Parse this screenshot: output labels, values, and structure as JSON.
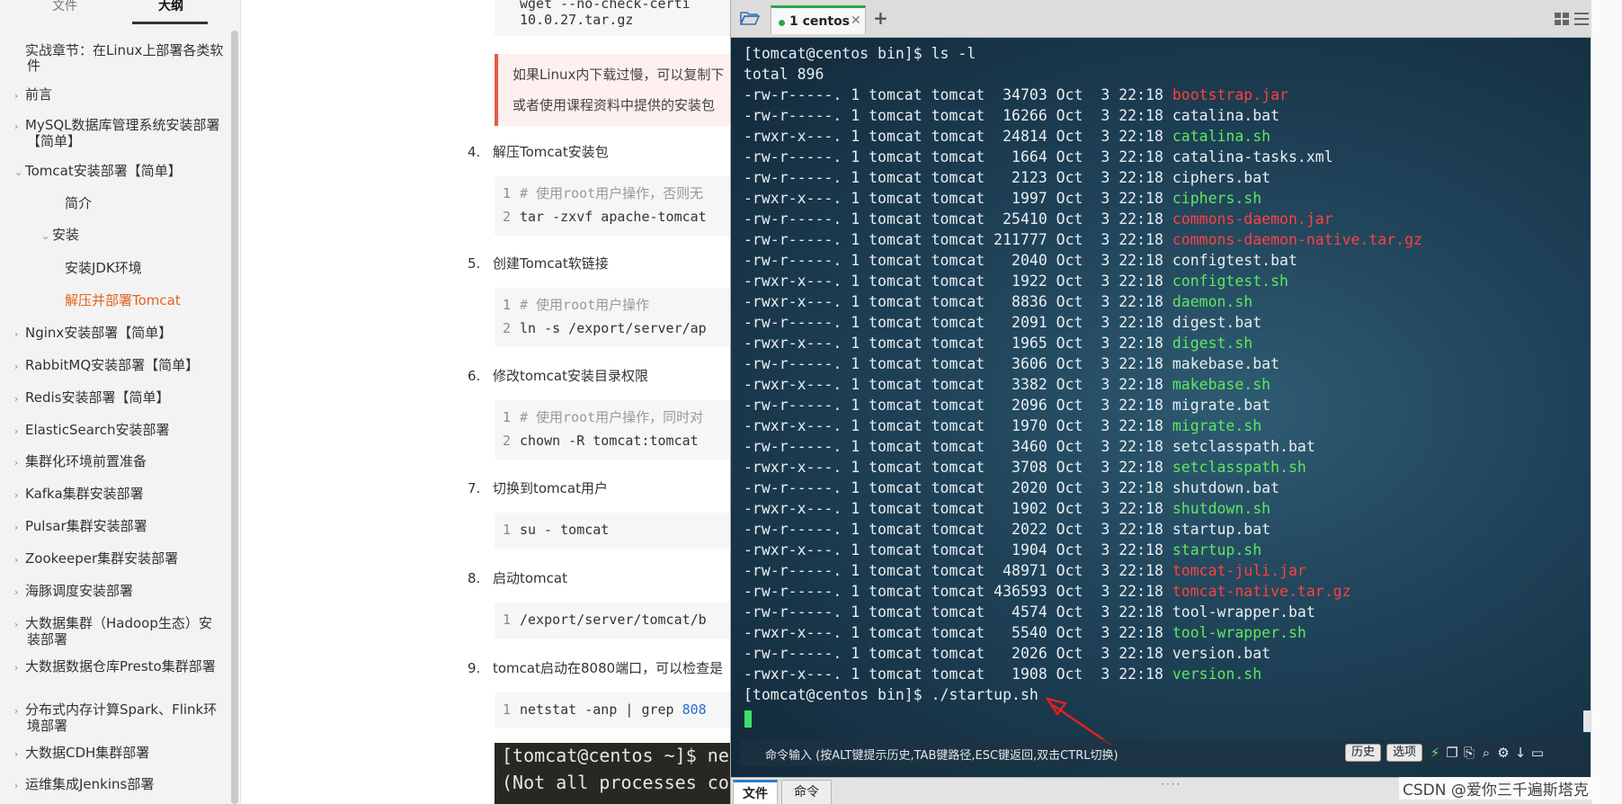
{
  "sidebar": {
    "tabs": [
      "文件",
      "大纲"
    ],
    "items": [
      {
        "label": "实战章节：在Linux上部署各类软件",
        "chev": ""
      },
      {
        "label": "前言",
        "chev": "›"
      },
      {
        "label": "MySQL数据库管理系统安装部署【简单】",
        "chev": "›"
      },
      {
        "label": "Tomcat安装部署【简单】",
        "chev": "⌄"
      },
      {
        "label": "简介",
        "chev": ""
      },
      {
        "label": "安装",
        "chev": "⌄"
      },
      {
        "label": "安装JDK环境",
        "chev": ""
      },
      {
        "label": "解压并部署Tomcat",
        "chev": ""
      },
      {
        "label": "Nginx安装部署【简单】",
        "chev": "›"
      },
      {
        "label": "RabbitMQ安装部署【简单】",
        "chev": "›"
      },
      {
        "label": "Redis安装部署【简单】",
        "chev": "›"
      },
      {
        "label": "ElasticSearch安装部署",
        "chev": "›"
      },
      {
        "label": "集群化环境前置准备",
        "chev": "›"
      },
      {
        "label": "Kafka集群安装部署",
        "chev": "›"
      },
      {
        "label": "Pulsar集群安装部署",
        "chev": "›"
      },
      {
        "label": "Zookeeper集群安装部署",
        "chev": "›"
      },
      {
        "label": "海豚调度安装部署",
        "chev": "›"
      },
      {
        "label": "大数据集群（Hadoop生态）安装部署",
        "chev": "›"
      },
      {
        "label": "大数据数据仓库Presto集群部署",
        "chev": "›"
      },
      {
        "label": "分布式内存计算Spark、Flink环境部署",
        "chev": "›"
      },
      {
        "label": "大数据CDH集群部署",
        "chev": "›"
      },
      {
        "label": "运维集成Jenkins部署",
        "chev": "›"
      }
    ]
  },
  "doc": {
    "top_code": [
      "wget --no-check-certi",
      "10.0.27.tar.gz"
    ],
    "tip": [
      "如果Linux内下载过慢，可以复制下",
      "或者使用课程资料中提供的安装包"
    ],
    "steps": [
      {
        "num": "4.",
        "title": "解压Tomcat安装包",
        "lines": [
          {
            "ln": "1",
            "comment": "# 使用root用户操作，否则无",
            "code": ""
          },
          {
            "ln": "2",
            "comment": "",
            "code": "tar -zxvf apache-tomcat"
          }
        ]
      },
      {
        "num": "5.",
        "title": "创建Tomcat软链接",
        "lines": [
          {
            "ln": "1",
            "comment": "# 使用root用户操作",
            "code": ""
          },
          {
            "ln": "2",
            "comment": "",
            "code": "ln -s /export/server/ap"
          }
        ]
      },
      {
        "num": "6.",
        "title": "修改tomcat安装目录权限",
        "lines": [
          {
            "ln": "1",
            "comment": "# 使用root用户操作，同时对",
            "code": ""
          },
          {
            "ln": "2",
            "comment": "",
            "code": "chown -R tomcat:tomcat"
          }
        ]
      },
      {
        "num": "7.",
        "title": "切换到tomcat用户",
        "lines": [
          {
            "ln": "1",
            "comment": "",
            "code": "su - tomcat"
          }
        ]
      },
      {
        "num": "8.",
        "title": "启动tomcat",
        "lines": [
          {
            "ln": "1",
            "comment": "",
            "code": "/export/server/tomcat/b"
          }
        ]
      },
      {
        "num": "9.",
        "title": "tomcat启动在8080端口，可以检查是",
        "lines": [
          {
            "ln": "1",
            "comment": "",
            "code": "netstat -anp | grep ",
            "blue": "808"
          }
        ]
      }
    ],
    "dark_block": [
      "[tomcat@centos ~]$ net",
      "(Not all processes cou"
    ]
  },
  "terminal": {
    "tab_label": "1 centos",
    "prompt_ls": "[tomcat@centos bin]$ ls -l",
    "total": "total 896",
    "files": [
      {
        "perm": "-rw-r-----.",
        "size": "34703",
        "name": "bootstrap.jar",
        "color": "red"
      },
      {
        "perm": "-rw-r-----.",
        "size": "16266",
        "name": "catalina.bat",
        "color": "white"
      },
      {
        "perm": "-rwxr-x---.",
        "size": "24814",
        "name": "catalina.sh",
        "color": "green"
      },
      {
        "perm": "-rw-r-----.",
        "size": "1664",
        "name": "catalina-tasks.xml",
        "color": "white"
      },
      {
        "perm": "-rw-r-----.",
        "size": "2123",
        "name": "ciphers.bat",
        "color": "white"
      },
      {
        "perm": "-rwxr-x---.",
        "size": "1997",
        "name": "ciphers.sh",
        "color": "green"
      },
      {
        "perm": "-rw-r-----.",
        "size": "25410",
        "name": "commons-daemon.jar",
        "color": "red"
      },
      {
        "perm": "-rw-r-----.",
        "size": "211777",
        "name": "commons-daemon-native.tar.gz",
        "color": "red"
      },
      {
        "perm": "-rw-r-----.",
        "size": "2040",
        "name": "configtest.bat",
        "color": "white"
      },
      {
        "perm": "-rwxr-x---.",
        "size": "1922",
        "name": "configtest.sh",
        "color": "green"
      },
      {
        "perm": "-rwxr-x---.",
        "size": "8836",
        "name": "daemon.sh",
        "color": "green"
      },
      {
        "perm": "-rw-r-----.",
        "size": "2091",
        "name": "digest.bat",
        "color": "white"
      },
      {
        "perm": "-rwxr-x---.",
        "size": "1965",
        "name": "digest.sh",
        "color": "green"
      },
      {
        "perm": "-rw-r-----.",
        "size": "3606",
        "name": "makebase.bat",
        "color": "white"
      },
      {
        "perm": "-rwxr-x---.",
        "size": "3382",
        "name": "makebase.sh",
        "color": "green"
      },
      {
        "perm": "-rw-r-----.",
        "size": "2096",
        "name": "migrate.bat",
        "color": "white"
      },
      {
        "perm": "-rwxr-x---.",
        "size": "1970",
        "name": "migrate.sh",
        "color": "green"
      },
      {
        "perm": "-rw-r-----.",
        "size": "3460",
        "name": "setclasspath.bat",
        "color": "white"
      },
      {
        "perm": "-rwxr-x---.",
        "size": "3708",
        "name": "setclasspath.sh",
        "color": "green"
      },
      {
        "perm": "-rw-r-----.",
        "size": "2020",
        "name": "shutdown.bat",
        "color": "white"
      },
      {
        "perm": "-rwxr-x---.",
        "size": "1902",
        "name": "shutdown.sh",
        "color": "green"
      },
      {
        "perm": "-rw-r-----.",
        "size": "2022",
        "name": "startup.bat",
        "color": "white"
      },
      {
        "perm": "-rwxr-x---.",
        "size": "1904",
        "name": "startup.sh",
        "color": "green"
      },
      {
        "perm": "-rw-r-----.",
        "size": "48971",
        "name": "tomcat-juli.jar",
        "color": "red"
      },
      {
        "perm": "-rw-r-----.",
        "size": "436593",
        "name": "tomcat-native.tar.gz",
        "color": "red"
      },
      {
        "perm": "-rw-r-----.",
        "size": "4574",
        "name": "tool-wrapper.bat",
        "color": "white"
      },
      {
        "perm": "-rwxr-x---.",
        "size": "5540",
        "name": "tool-wrapper.sh",
        "color": "green"
      },
      {
        "perm": "-rw-r-----.",
        "size": "2026",
        "name": "version.bat",
        "color": "white"
      },
      {
        "perm": "-rwxr-x---.",
        "size": "1908",
        "name": "version.sh",
        "color": "green"
      }
    ],
    "links": "1",
    "owner": "tomcat",
    "group": "tomcat",
    "month": "Oct",
    "day": "3",
    "time": "22:18",
    "prompt_startup": "[tomcat@centos bin]$ ./startup.sh",
    "cmd_hint": "命令输入 (按ALT键提示历史,TAB键路径,ESC键返回,双击CTRL切换)",
    "btn_history": "历史",
    "btn_options": "选项",
    "bottom_tabs": [
      "文件",
      "命令"
    ]
  },
  "watermark": "CSDN @爱你三千遍斯塔克",
  "colors": {
    "term_red": "#ff4040",
    "term_green": "#5fe85f",
    "tab_green": "#2aa84a",
    "active_orange": "#e0651e"
  }
}
